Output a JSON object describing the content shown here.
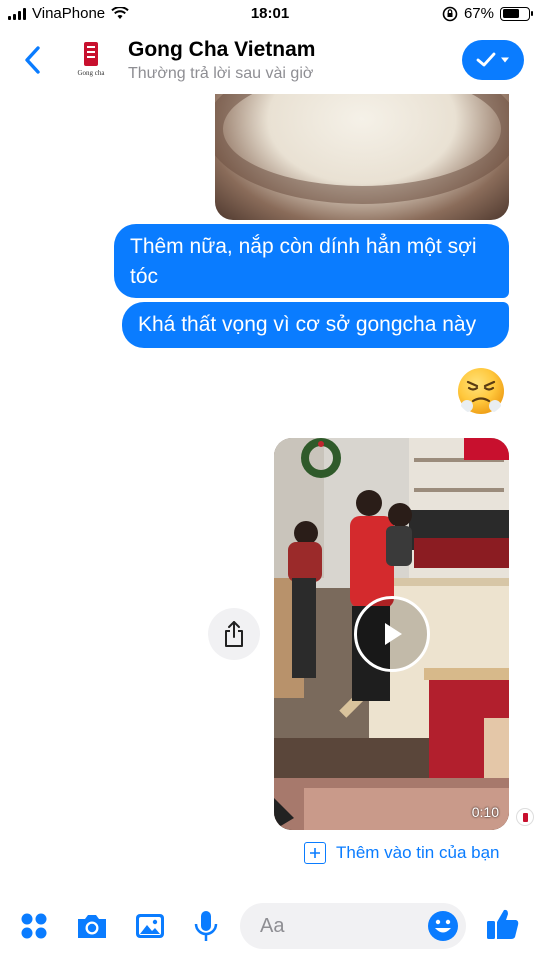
{
  "status_bar": {
    "carrier": "VinaPhone",
    "time": "18:01",
    "battery_percent": "67%",
    "battery_level": 0.67
  },
  "header": {
    "contact_name": "Gong Cha Vietnam",
    "contact_status": "Thường trả lời sau vài giờ",
    "avatar_text": "Gong cha",
    "accent_color": "#0a7cff"
  },
  "messages": {
    "text1": "Thêm nữa, nắp còn dính hẳn một sợi tóc",
    "text2": "Khá thất vọng vì cơ sở gongcha này",
    "emoji": "steam-from-nose-face-icon",
    "video_duration": "0:10"
  },
  "add_to_story": {
    "label": "Thêm vào tin của bạn"
  },
  "composer": {
    "placeholder": "Aa",
    "icons": [
      "more-apps-icon",
      "camera-icon",
      "gallery-icon",
      "microphone-icon",
      "emoji-icon",
      "thumbs-up-icon"
    ]
  }
}
